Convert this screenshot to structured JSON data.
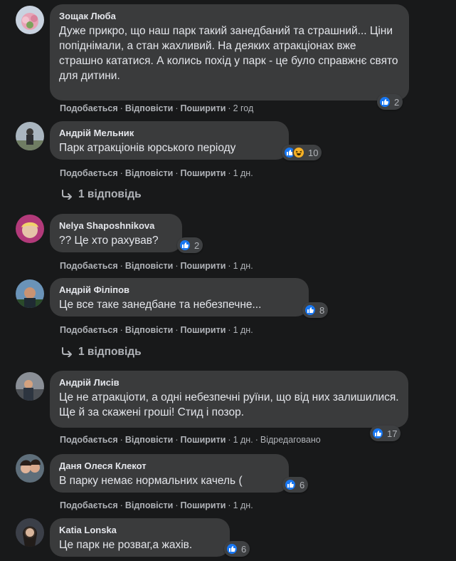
{
  "labels": {
    "like": "Подобається",
    "reply": "Відповісти",
    "share": "Поширити"
  },
  "colors": {
    "background": "#18191a",
    "bubble": "#3a3b3c",
    "like_blue": "#1877f2",
    "secondary_text": "#b0b3b8"
  },
  "comments": [
    {
      "author": "Зощак Люба",
      "text": "Дуже прикро, що наш парк такий занедбаний та страшний... Ціни попіднімали, а стан жахливий. На деяких атракціонах вже страшно кататися. А колись похід у парк - це було справжнє свято для дитини.",
      "time": "2 год",
      "reaction_count": "2",
      "icons": [
        "like-icon"
      ]
    },
    {
      "author": "Андрій Мельник",
      "text": "Парк атракціонів юрського періоду",
      "time": "1 дн.",
      "reaction_count": "10",
      "icons": [
        "like-icon",
        "haha-icon"
      ],
      "replies_label": "1 відповідь"
    },
    {
      "author": "Nelya Shaposhnikova",
      "text": "?? Це хто рахував?",
      "time": "1 дн.",
      "reaction_count": "2",
      "icons": [
        "like-icon"
      ]
    },
    {
      "author": "Андрій Філіпов",
      "text": "Це все таке занедбане та небезпечне...",
      "time": "1 дн.",
      "reaction_count": "8",
      "icons": [
        "like-icon"
      ],
      "replies_label": "1 відповідь"
    },
    {
      "author": "Андрій Лисів",
      "text": "Це не атракціоти, а одні небезпечні руїни, що від них залишилися. Ще й за скажені гроші! Стид і позор.",
      "time": "1 дн.",
      "edited": "Відредаговано",
      "reaction_count": "17",
      "icons": [
        "like-icon"
      ]
    },
    {
      "author": "Даня Олеся Клекот",
      "text": "В парку немає нормальних качель (",
      "time": "1 дн.",
      "reaction_count": "6",
      "icons": [
        "like-icon"
      ]
    },
    {
      "author": "Katia Lonska",
      "text": "Це парк не розваг,а жахів.",
      "reaction_count": "6",
      "icons": [
        "like-icon"
      ]
    }
  ]
}
